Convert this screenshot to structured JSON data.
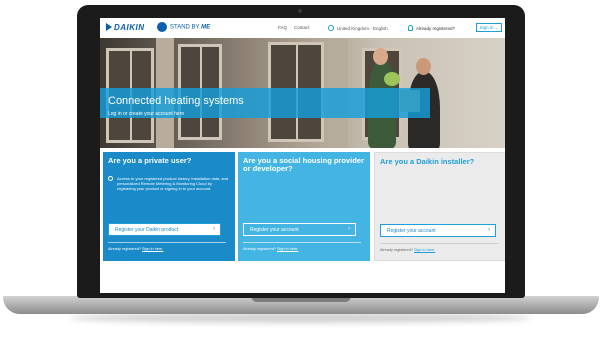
{
  "header": {
    "logo_text": "DAIKIN",
    "stand_by": "STAND BY",
    "stand_me": "ME",
    "faq": "FAQ",
    "contact": "Contact",
    "region": "United Kingdom - English",
    "already_registered": "Already registered?",
    "sign_in": "Sign in"
  },
  "hero": {
    "title": "Connected heating systems",
    "subtitle": "Log in or create your account here"
  },
  "cards": [
    {
      "title": "Are you a private user?",
      "description": "Access to your registered product history, installation data, and personalized Remote Metering & Monitoring Cloud by registering your product or signing in to your account.",
      "button": "Register your Daikin product",
      "foot_text": "Already registered?",
      "foot_link": "Sign in here."
    },
    {
      "title": "Are you a social housing provider or developer?",
      "button": "Register your account",
      "foot_text": "Already registered?",
      "foot_link": "Sign in here."
    },
    {
      "title": "Are you a Daikin installer?",
      "button": "Register your account",
      "foot_text": "Already registered?",
      "foot_link": "Sign in here."
    }
  ],
  "colors": {
    "brand_blue": "#0a5eab",
    "accent_blue": "#1f9ed9",
    "card_dark": "#1a8ac8",
    "card_light": "#44b4e2",
    "card_grey": "#ebebeb"
  }
}
